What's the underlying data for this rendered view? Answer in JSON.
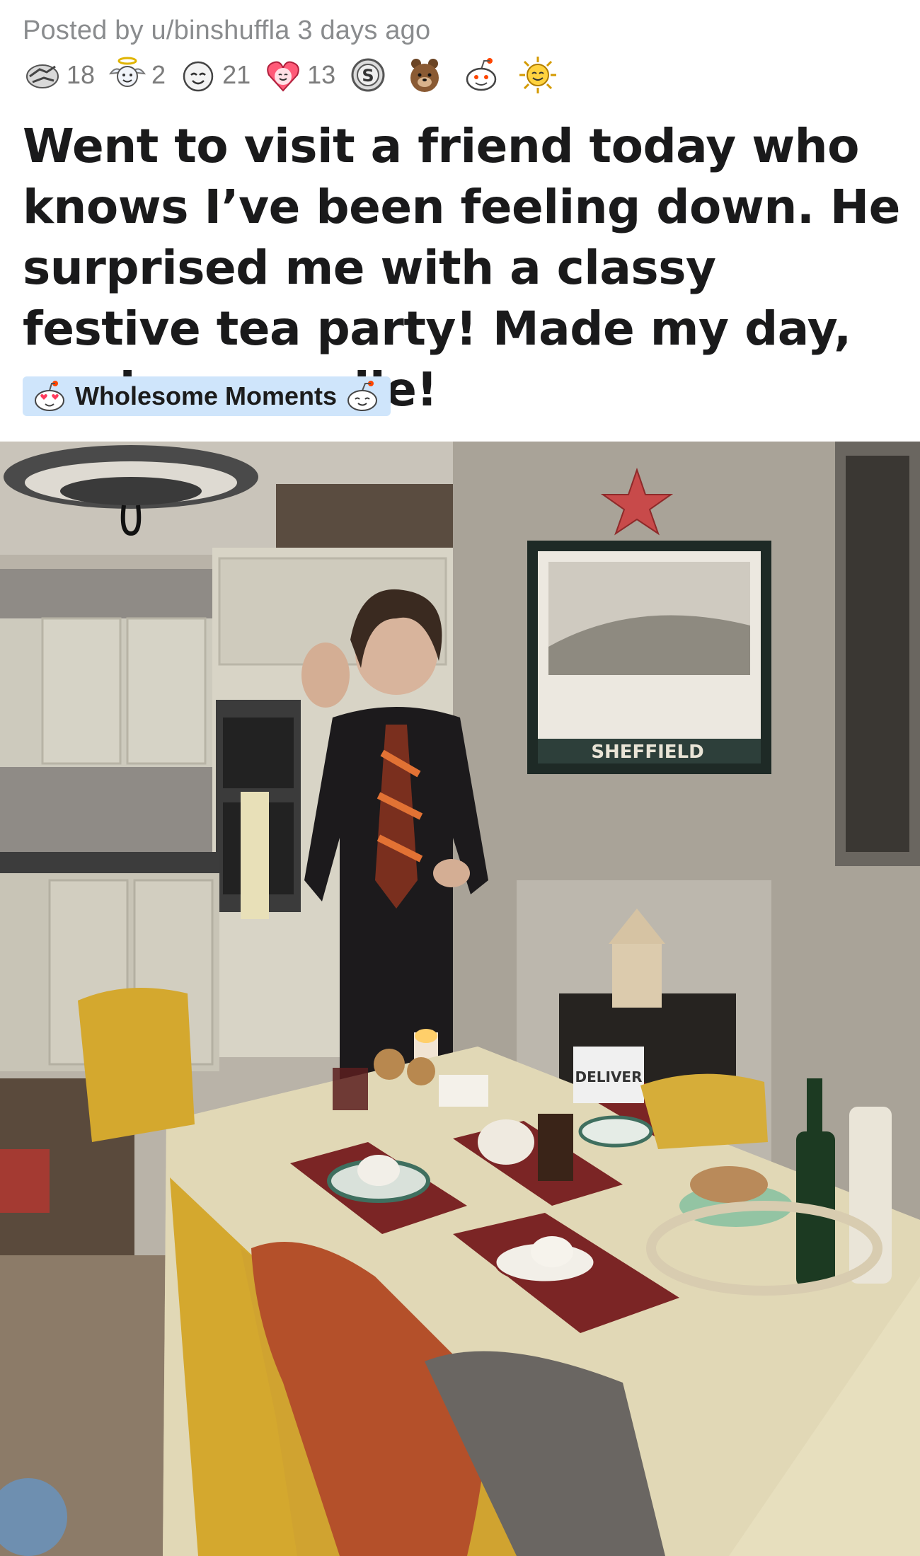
{
  "post": {
    "meta": "Posted by u/binshuffla 3 days ago",
    "title": "Went to visit a friend today who knows I’ve been feeling down. He surprised me with a classy festive tea party! Made my day, made me smile!",
    "flair": "Wholesome Moments",
    "flair_color": "#cfe5fb"
  },
  "awards": [
    {
      "icon": "helpful-hands-icon",
      "count": "18"
    },
    {
      "icon": "angel-award-icon",
      "count": "2"
    },
    {
      "icon": "wholesome-award-icon",
      "count": "21"
    },
    {
      "icon": "heart-eyes-icon",
      "count": "13"
    },
    {
      "icon": "silver-award-icon",
      "count": ""
    },
    {
      "icon": "bear-award-icon",
      "count": ""
    },
    {
      "icon": "snoo-award-icon",
      "count": ""
    },
    {
      "icon": "sun-award-icon",
      "count": ""
    }
  ],
  "photo": {
    "subject": "man in black suit and striped tie waving beside a set tea table in a kitchen",
    "poster_text": "SHEFFIELD",
    "bag_text": "DELIVER"
  }
}
